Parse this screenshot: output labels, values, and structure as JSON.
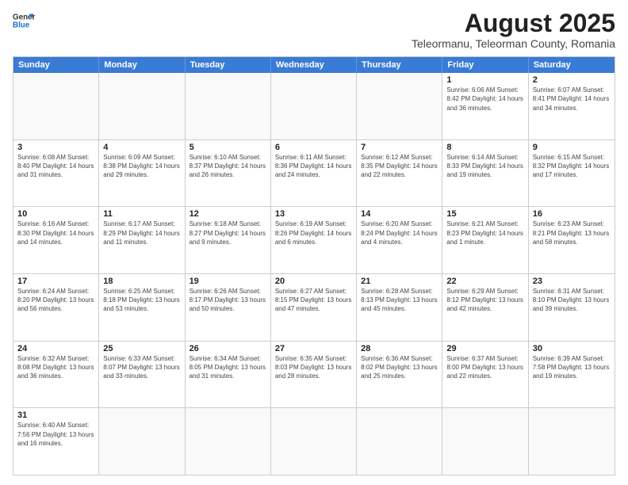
{
  "header": {
    "logo_general": "General",
    "logo_blue": "Blue",
    "month_title": "August 2025",
    "location": "Teleormanu, Teleorman County, Romania"
  },
  "days_of_week": [
    "Sunday",
    "Monday",
    "Tuesday",
    "Wednesday",
    "Thursday",
    "Friday",
    "Saturday"
  ],
  "weeks": [
    [
      {
        "day": "",
        "info": ""
      },
      {
        "day": "",
        "info": ""
      },
      {
        "day": "",
        "info": ""
      },
      {
        "day": "",
        "info": ""
      },
      {
        "day": "",
        "info": ""
      },
      {
        "day": "1",
        "info": "Sunrise: 6:06 AM\nSunset: 8:42 PM\nDaylight: 14 hours and 36 minutes."
      },
      {
        "day": "2",
        "info": "Sunrise: 6:07 AM\nSunset: 8:41 PM\nDaylight: 14 hours and 34 minutes."
      }
    ],
    [
      {
        "day": "3",
        "info": "Sunrise: 6:08 AM\nSunset: 8:40 PM\nDaylight: 14 hours and 31 minutes."
      },
      {
        "day": "4",
        "info": "Sunrise: 6:09 AM\nSunset: 8:38 PM\nDaylight: 14 hours and 29 minutes."
      },
      {
        "day": "5",
        "info": "Sunrise: 6:10 AM\nSunset: 8:37 PM\nDaylight: 14 hours and 26 minutes."
      },
      {
        "day": "6",
        "info": "Sunrise: 6:11 AM\nSunset: 8:36 PM\nDaylight: 14 hours and 24 minutes."
      },
      {
        "day": "7",
        "info": "Sunrise: 6:12 AM\nSunset: 8:35 PM\nDaylight: 14 hours and 22 minutes."
      },
      {
        "day": "8",
        "info": "Sunrise: 6:14 AM\nSunset: 8:33 PM\nDaylight: 14 hours and 19 minutes."
      },
      {
        "day": "9",
        "info": "Sunrise: 6:15 AM\nSunset: 8:32 PM\nDaylight: 14 hours and 17 minutes."
      }
    ],
    [
      {
        "day": "10",
        "info": "Sunrise: 6:16 AM\nSunset: 8:30 PM\nDaylight: 14 hours and 14 minutes."
      },
      {
        "day": "11",
        "info": "Sunrise: 6:17 AM\nSunset: 8:29 PM\nDaylight: 14 hours and 11 minutes."
      },
      {
        "day": "12",
        "info": "Sunrise: 6:18 AM\nSunset: 8:27 PM\nDaylight: 14 hours and 9 minutes."
      },
      {
        "day": "13",
        "info": "Sunrise: 6:19 AM\nSunset: 8:26 PM\nDaylight: 14 hours and 6 minutes."
      },
      {
        "day": "14",
        "info": "Sunrise: 6:20 AM\nSunset: 8:24 PM\nDaylight: 14 hours and 4 minutes."
      },
      {
        "day": "15",
        "info": "Sunrise: 6:21 AM\nSunset: 8:23 PM\nDaylight: 14 hours and 1 minute."
      },
      {
        "day": "16",
        "info": "Sunrise: 6:23 AM\nSunset: 8:21 PM\nDaylight: 13 hours and 58 minutes."
      }
    ],
    [
      {
        "day": "17",
        "info": "Sunrise: 6:24 AM\nSunset: 8:20 PM\nDaylight: 13 hours and 56 minutes."
      },
      {
        "day": "18",
        "info": "Sunrise: 6:25 AM\nSunset: 8:18 PM\nDaylight: 13 hours and 53 minutes."
      },
      {
        "day": "19",
        "info": "Sunrise: 6:26 AM\nSunset: 8:17 PM\nDaylight: 13 hours and 50 minutes."
      },
      {
        "day": "20",
        "info": "Sunrise: 6:27 AM\nSunset: 8:15 PM\nDaylight: 13 hours and 47 minutes."
      },
      {
        "day": "21",
        "info": "Sunrise: 6:28 AM\nSunset: 8:13 PM\nDaylight: 13 hours and 45 minutes."
      },
      {
        "day": "22",
        "info": "Sunrise: 6:29 AM\nSunset: 8:12 PM\nDaylight: 13 hours and 42 minutes."
      },
      {
        "day": "23",
        "info": "Sunrise: 6:31 AM\nSunset: 8:10 PM\nDaylight: 13 hours and 39 minutes."
      }
    ],
    [
      {
        "day": "24",
        "info": "Sunrise: 6:32 AM\nSunset: 8:08 PM\nDaylight: 13 hours and 36 minutes."
      },
      {
        "day": "25",
        "info": "Sunrise: 6:33 AM\nSunset: 8:07 PM\nDaylight: 13 hours and 33 minutes."
      },
      {
        "day": "26",
        "info": "Sunrise: 6:34 AM\nSunset: 8:05 PM\nDaylight: 13 hours and 31 minutes."
      },
      {
        "day": "27",
        "info": "Sunrise: 6:35 AM\nSunset: 8:03 PM\nDaylight: 13 hours and 28 minutes."
      },
      {
        "day": "28",
        "info": "Sunrise: 6:36 AM\nSunset: 8:02 PM\nDaylight: 13 hours and 25 minutes."
      },
      {
        "day": "29",
        "info": "Sunrise: 6:37 AM\nSunset: 8:00 PM\nDaylight: 13 hours and 22 minutes."
      },
      {
        "day": "30",
        "info": "Sunrise: 6:39 AM\nSunset: 7:58 PM\nDaylight: 13 hours and 19 minutes."
      }
    ],
    [
      {
        "day": "31",
        "info": "Sunrise: 6:40 AM\nSunset: 7:56 PM\nDaylight: 13 hours and 16 minutes."
      },
      {
        "day": "",
        "info": ""
      },
      {
        "day": "",
        "info": ""
      },
      {
        "day": "",
        "info": ""
      },
      {
        "day": "",
        "info": ""
      },
      {
        "day": "",
        "info": ""
      },
      {
        "day": "",
        "info": ""
      }
    ]
  ]
}
